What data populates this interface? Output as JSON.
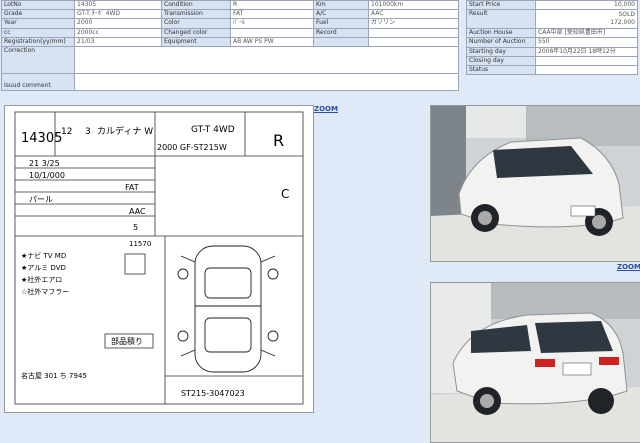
{
  "info": {
    "rows": [
      [
        {
          "label": "LotNo",
          "value": "14305"
        },
        {
          "label": "Condition",
          "value": "R"
        },
        {
          "label": "Km",
          "value": "101000km"
        }
      ],
      [
        {
          "label": "Grade",
          "value": "GT-T ﾀｰﾎﾞ 4WD"
        },
        {
          "label": "Transmission",
          "value": "FAT"
        },
        {
          "label": "A/C",
          "value": "AAC"
        }
      ],
      [
        {
          "label": "Year",
          "value": "2000"
        },
        {
          "label": "Color",
          "value": "ﾊﾟｰﾙ"
        },
        {
          "label": "Fuel",
          "value": "ガソリン"
        }
      ],
      [
        {
          "label": "cc",
          "value": "2000cc"
        },
        {
          "label": "Changed color",
          "value": ""
        },
        {
          "label": "Record",
          "value": ""
        }
      ],
      [
        {
          "label": "Registration(yy/mm)",
          "value": "21/03"
        },
        {
          "label": "Equipment",
          "value": "AB AW PS PW"
        },
        {
          "label": "",
          "value": ""
        }
      ]
    ],
    "correction_label": "Correction",
    "correction_value": "",
    "issued_label": "Isuud comment",
    "issued_value": ""
  },
  "right": {
    "rows": [
      {
        "label": "Start Price",
        "value": "10,000"
      },
      {
        "label": "Result",
        "value": "SOLD\n172,000"
      },
      {
        "label": "Auction House",
        "value": "CAA中部 [愛知県豊田市]"
      },
      {
        "label": "Number of Auction",
        "value": "550"
      },
      {
        "label": "Starting day",
        "value": "2008年10月22日 18時12分"
      },
      {
        "label": "Closing day",
        "value": ""
      },
      {
        "label": "Status",
        "value": ""
      }
    ]
  },
  "zoom_label": "ZOOM",
  "sheet": {
    "lot": "14305",
    "year": "12",
    "month": "3",
    "model": "カルディナ W",
    "grade": "GT-T 4WD",
    "grade_code": "2000  GF-ST215W",
    "score": "R",
    "inspect_date": "21  3/25",
    "mileage": "10/1/000",
    "fuel_label": "ガソリン",
    "trans": "FAT",
    "ac": "AAC",
    "color": "パール",
    "seats": "5",
    "number": "11570",
    "score_c": "C",
    "chassis": "ST215-3047023",
    "notes": [
      "★ナビ TV MD",
      "★アルミ DVD",
      "★社外エアロ",
      "☆社外マフラー",
      "名古屋 301 ち 7945"
    ],
    "stamp": "部品積り"
  }
}
